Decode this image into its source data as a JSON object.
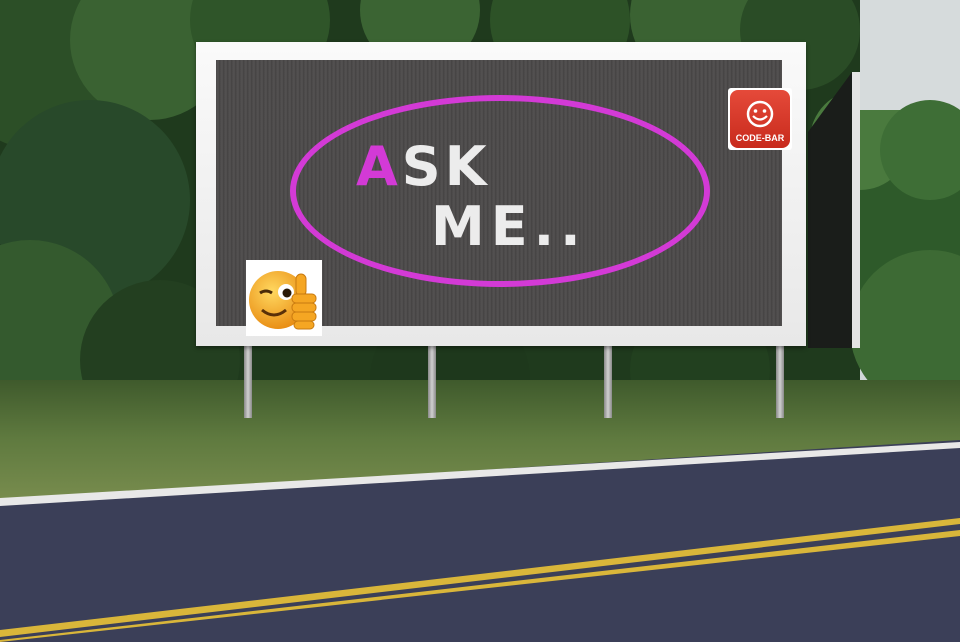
{
  "billboard": {
    "line1_first_letter": "A",
    "line1_rest": "SK",
    "line2": "ME..",
    "logo_text": "CODE-BAR",
    "logo_icon": "smiley-icon",
    "emoji_icon": "winking-thumbs-up-emoji",
    "colors": {
      "accent_magenta": "#d33ad6",
      "screen_gray": "#4a4848",
      "text_white": "#ececec",
      "logo_red": "#d6362a",
      "emoji_yellow": "#f5a623"
    }
  },
  "road": {
    "center_line_color": "#d9b63a",
    "edge_line_color": "#e8e8e8"
  }
}
